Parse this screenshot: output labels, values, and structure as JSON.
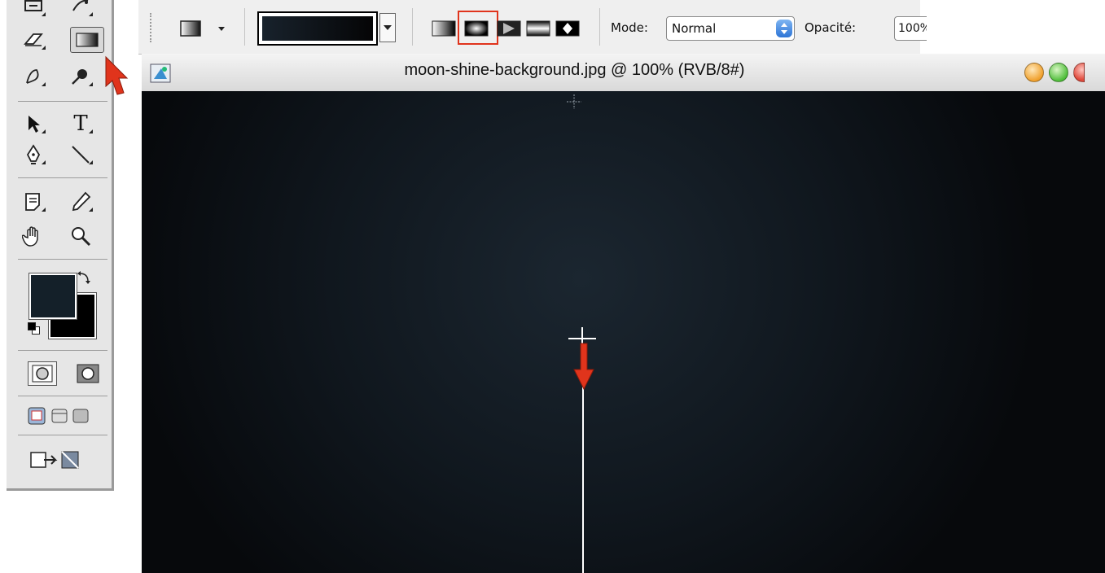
{
  "tools": {
    "foreground_color": "#142029",
    "background_color": "#000000",
    "items": [
      "history-brush",
      "art-history-brush",
      "eraser",
      "gradient",
      "blur",
      "dodge",
      "path-selection",
      "type",
      "pen",
      "line",
      "notes",
      "eyedropper",
      "hand",
      "zoom"
    ],
    "type_tool_glyph": "T"
  },
  "options_bar": {
    "gradient_colors": [
      "#18222c",
      "#050506"
    ],
    "gradient_types": [
      "linear",
      "radial",
      "angle",
      "reflected",
      "diamond"
    ],
    "selected_type": "radial",
    "mode_label": "Mode:",
    "mode_value": "Normal",
    "opacity_label": "Opacité:",
    "opacity_value": "100%"
  },
  "document": {
    "title": "moon-shine-background.jpg @ 100% (RVB/8#)",
    "canvas_color": "#10171e"
  },
  "highlight_color": "#e0341c"
}
